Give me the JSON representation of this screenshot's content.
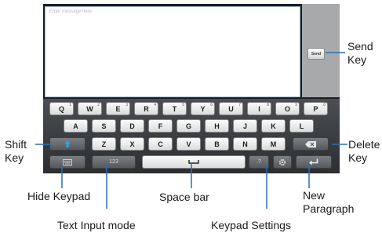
{
  "message": {
    "placeholder": "Enter message here"
  },
  "send_button": {
    "label": "Send"
  },
  "keyboard": {
    "row1": [
      {
        "key": "Q",
        "num": "1"
      },
      {
        "key": "W",
        "num": "2"
      },
      {
        "key": "E",
        "num": "3"
      },
      {
        "key": "R",
        "num": "4"
      },
      {
        "key": "T",
        "num": "5"
      },
      {
        "key": "Y",
        "num": "6"
      },
      {
        "key": "U",
        "num": "7"
      },
      {
        "key": "I",
        "num": "8"
      },
      {
        "key": "O",
        "num": "9"
      },
      {
        "key": "P",
        "num": "0"
      }
    ],
    "row2": [
      "A",
      "S",
      "D",
      "F",
      "G",
      "H",
      "J",
      "K",
      "L"
    ],
    "row3": [
      "Z",
      "X",
      "C",
      "V",
      "B",
      "N",
      "M"
    ],
    "mode_key": "123",
    "punct_key": ".?"
  },
  "callouts": {
    "send_key": [
      "Send",
      "Key"
    ],
    "shift_key": [
      "Shift",
      "Key"
    ],
    "delete_key": [
      "Delete",
      "Key"
    ],
    "hide_keypad": "Hide Keypad",
    "space_bar": "Space bar",
    "new_paragraph": [
      "New",
      "Paragraph"
    ],
    "text_input_mode": "Text Input mode",
    "keypad_settings": "Keypad Settings"
  },
  "icons": {
    "shift": "shift-arrow-icon",
    "delete": "backspace-icon",
    "hide_keypad": "keyboard-icon",
    "space": "space-bracket-icon",
    "settings": "gear-icon",
    "enter": "return-arrow-icon"
  },
  "colors": {
    "keyboard_bg": "#3a3c3f",
    "key_face": "#f0f0f0",
    "shift_accent": "#2ea3e0",
    "field_border": "#9cb9d4"
  }
}
